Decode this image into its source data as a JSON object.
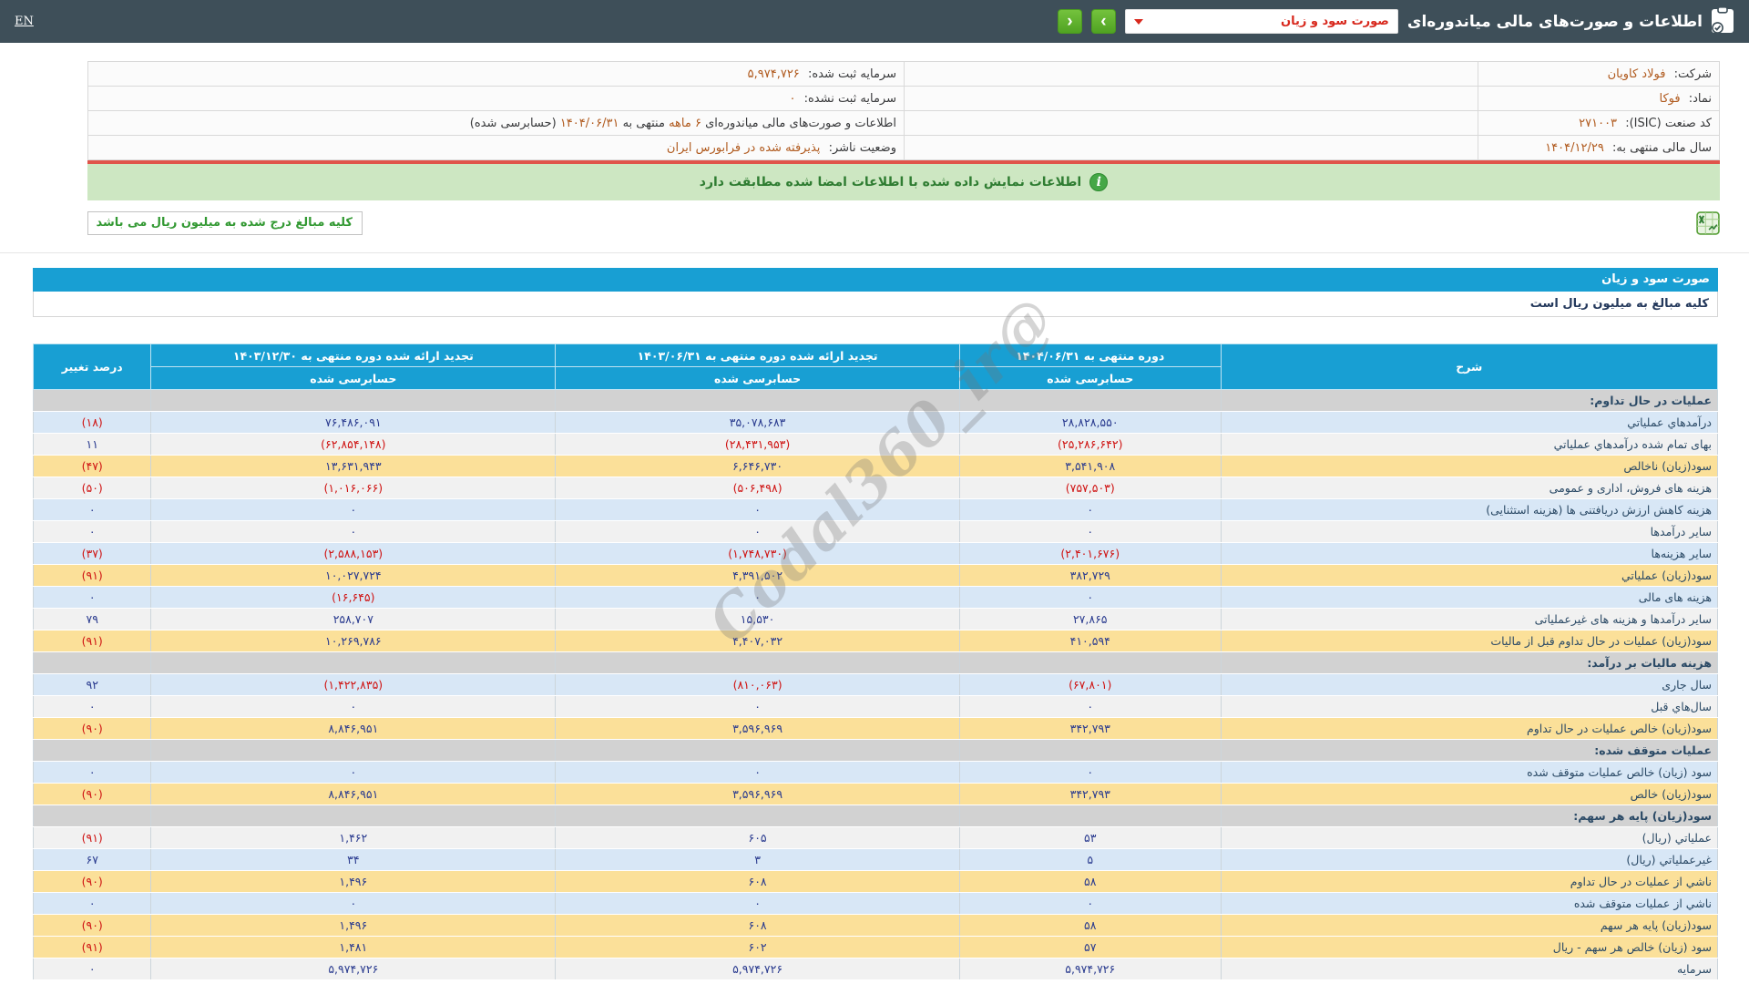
{
  "colors": {
    "topbar_bg": "#3e4f59",
    "nav_button_green": "#58b32c",
    "select_text_red": "#d8281d",
    "table_header_blue": "#189fd3",
    "row_blue": "#d8e7f6",
    "row_plain": "#f1f1f1",
    "row_yellow": "#fbe099",
    "row_section_gray": "#d2d2d2",
    "value_blue": "#2a3b8f",
    "negative_red": "#cf1312",
    "highlight_orange": "#b05a1e",
    "banner_green_bg": "#cde7c2",
    "banner_text_green": "#2f7d32",
    "red_divider": "#e0544a"
  },
  "topbar": {
    "title": "اطلاعات و صورت‌های مالی میاندوره‌ای",
    "select_value": "صورت سود و زیان",
    "prev_label": "‹",
    "next_label": "›",
    "en_link": "EN"
  },
  "info": {
    "rows": [
      {
        "a_label": "شرکت:",
        "a_value": "فولاد کاویان",
        "b_label": "سرمایه ثبت شده:",
        "b_value": "۵,۹۷۴,۷۲۶"
      },
      {
        "a_label": "نماد:",
        "a_value": "فوکا",
        "b_label": "سرمایه ثبت نشده:",
        "b_value": "۰"
      },
      {
        "a_label": "کد صنعت (ISIC):",
        "a_value": "۲۷۱۰۰۳",
        "b_label": "",
        "b_value": ""
      },
      {
        "a_label": "سال مالی منتهی به:",
        "a_value": "۱۴۰۴/۱۲/۲۹",
        "b_label": "وضعیت ناشر:",
        "b_value": "پذیرفته شده در فرابورس ایران"
      }
    ],
    "report_line": {
      "prefix": "اطلاعات و صورت‌های مالی میاندوره‌ای",
      "period": "۶ ماهه",
      "middle": "منتهی به",
      "date": "۱۴۰۴/۰۶/۳۱",
      "suffix": "(حسابرسی شده)"
    }
  },
  "banner": {
    "text": "اطلاعات نمایش داده شده با اطلاعات امضا شده مطابقت دارد"
  },
  "note": {
    "text": "کلیه مبالغ درج شده به میلیون ریال می باشد"
  },
  "statement": {
    "title": "صورت سود و زیان",
    "units": "کلیه مبالغ به میلیون ریال است",
    "watermark": "@Codal360_ir",
    "header": {
      "desc": "شرح",
      "col1": "دوره منتهی به ۱۴۰۴/۰۶/۳۱",
      "col2": "تجدید ارائه شده دوره منتهی به ۱۴۰۳/۰۶/۳۱",
      "col3": "تجدید ارائه شده دوره منتهی به ۱۴۰۳/۱۲/۳۰",
      "pct": "درصد تغییر",
      "audited": "حسابرسی شده"
    },
    "rows": [
      {
        "type": "section",
        "label": "عملیات در حال تداوم:",
        "v1": "",
        "v2": "",
        "v3": "",
        "pct": ""
      },
      {
        "type": "blue",
        "label": "درآمدهاي عملیاتي",
        "v1": "۲۸,۸۲۸,۵۵۰",
        "v2": "۳۵,۰۷۸,۶۸۳",
        "v3": "۷۶,۴۸۶,۰۹۱",
        "pct": "(۱۸)"
      },
      {
        "type": "plain",
        "label": "بهای تمام شده درآمدهاي عملیاتي",
        "v1": "(۲۵,۲۸۶,۶۴۲)",
        "v2": "(۲۸,۴۳۱,۹۵۳)",
        "v3": "(۶۲,۸۵۴,۱۴۸)",
        "pct": "۱۱"
      },
      {
        "type": "yellow",
        "label": "سود(زیان) ناخالص",
        "v1": "۳,۵۴۱,۹۰۸",
        "v2": "۶,۶۴۶,۷۳۰",
        "v3": "۱۳,۶۳۱,۹۴۳",
        "pct": "(۴۷)"
      },
      {
        "type": "plain",
        "label": "هزینه های فروش، اداری و عمومی",
        "v1": "(۷۵۷,۵۰۳)",
        "v2": "(۵۰۶,۴۹۸)",
        "v3": "(۱,۰۱۶,۰۶۶)",
        "pct": "(۵۰)"
      },
      {
        "type": "blue",
        "label": "هزینه کاهش ارزش دریافتنی ها (هزینه استثنایی)",
        "v1": "۰",
        "v2": "۰",
        "v3": "۰",
        "pct": "۰"
      },
      {
        "type": "plain",
        "label": "سایر درآمدها",
        "v1": "۰",
        "v2": "۰",
        "v3": "۰",
        "pct": "۰"
      },
      {
        "type": "blue",
        "label": "سایر هزینه‌ها",
        "v1": "(۲,۴۰۱,۶۷۶)",
        "v2": "(۱,۷۴۸,۷۳۰)",
        "v3": "(۲,۵۸۸,۱۵۳)",
        "pct": "(۳۷)"
      },
      {
        "type": "yellow",
        "label": "سود(زیان) عملیاتي",
        "v1": "۳۸۲,۷۲۹",
        "v2": "۴,۳۹۱,۵۰۲",
        "v3": "۱۰,۰۲۷,۷۲۴",
        "pct": "(۹۱)"
      },
      {
        "type": "blue",
        "label": "هزینه های مالی",
        "v1": "۰",
        "v2": "۰",
        "v3": "(۱۶,۶۴۵)",
        "pct": "۰"
      },
      {
        "type": "plain",
        "label": "سایر درآمدها و هزینه های غیرعملیاتی",
        "v1": "۲۷,۸۶۵",
        "v2": "۱۵,۵۳۰",
        "v3": "۲۵۸,۷۰۷",
        "pct": "۷۹"
      },
      {
        "type": "yellow",
        "label": "سود(زیان) عملیات در حال تداوم قبل از مالیات",
        "v1": "۴۱۰,۵۹۴",
        "v2": "۴,۴۰۷,۰۳۲",
        "v3": "۱۰,۲۶۹,۷۸۶",
        "pct": "(۹۱)"
      },
      {
        "type": "section",
        "label": "هزینه مالیات بر درآمد:",
        "v1": "",
        "v2": "",
        "v3": "",
        "pct": ""
      },
      {
        "type": "blue",
        "label": "سال جاری",
        "v1": "(۶۷,۸۰۱)",
        "v2": "(۸۱۰,۰۶۳)",
        "v3": "(۱,۴۲۲,۸۳۵)",
        "pct": "۹۲"
      },
      {
        "type": "plain",
        "label": "سال‌هاي قبل",
        "v1": "۰",
        "v2": "۰",
        "v3": "۰",
        "pct": "۰"
      },
      {
        "type": "yellow",
        "label": "سود(زیان) خالص عملیات در حال تداوم",
        "v1": "۳۴۲,۷۹۳",
        "v2": "۳,۵۹۶,۹۶۹",
        "v3": "۸,۸۴۶,۹۵۱",
        "pct": "(۹۰)"
      },
      {
        "type": "section",
        "label": "عملیات متوقف شده:",
        "v1": "",
        "v2": "",
        "v3": "",
        "pct": ""
      },
      {
        "type": "blue",
        "label": "سود (زیان) خالص عملیات متوقف شده",
        "v1": "۰",
        "v2": "۰",
        "v3": "۰",
        "pct": "۰"
      },
      {
        "type": "yellow",
        "label": "سود(زیان) خالص",
        "v1": "۳۴۲,۷۹۳",
        "v2": "۳,۵۹۶,۹۶۹",
        "v3": "۸,۸۴۶,۹۵۱",
        "pct": "(۹۰)"
      },
      {
        "type": "section",
        "label": "سود(زیان) پایه هر سهم:",
        "v1": "",
        "v2": "",
        "v3": "",
        "pct": ""
      },
      {
        "type": "plain",
        "label": "عملیاتي (ریال)",
        "v1": "۵۳",
        "v2": "۶۰۵",
        "v3": "۱,۴۶۲",
        "pct": "(۹۱)"
      },
      {
        "type": "blue",
        "label": "غیرعملیاتي (ریال)",
        "v1": "۵",
        "v2": "۳",
        "v3": "۳۴",
        "pct": "۶۷"
      },
      {
        "type": "yellow",
        "label": "ناشي از عملیات در حال تداوم",
        "v1": "۵۸",
        "v2": "۶۰۸",
        "v3": "۱,۴۹۶",
        "pct": "(۹۰)"
      },
      {
        "type": "blue",
        "label": "ناشي از عملیات متوقف شده",
        "v1": "۰",
        "v2": "۰",
        "v3": "۰",
        "pct": "۰"
      },
      {
        "type": "yellow",
        "label": "سود(زیان) پایه هر سهم",
        "v1": "۵۸",
        "v2": "۶۰۸",
        "v3": "۱,۴۹۶",
        "pct": "(۹۰)"
      },
      {
        "type": "yellow",
        "label": "سود (زیان) خالص هر سهم - ریال",
        "v1": "۵۷",
        "v2": "۶۰۲",
        "v3": "۱,۴۸۱",
        "pct": "(۹۱)"
      },
      {
        "type": "plain",
        "label": "سرمایه",
        "v1": "۵,۹۷۴,۷۲۶",
        "v2": "۵,۹۷۴,۷۲۶",
        "v3": "۵,۹۷۴,۷۲۶",
        "pct": "۰"
      }
    ]
  }
}
